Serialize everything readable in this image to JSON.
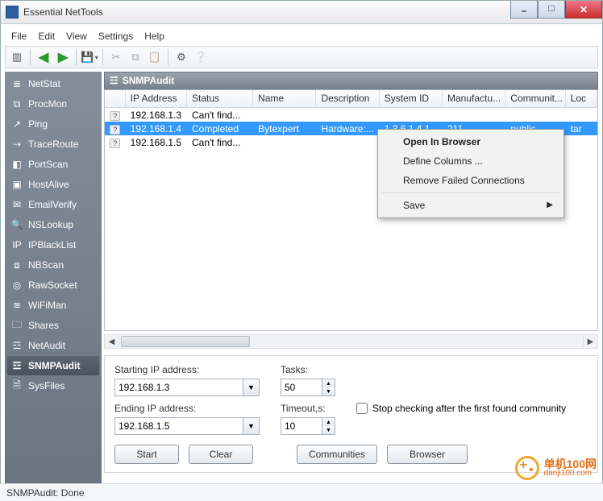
{
  "window": {
    "title": "Essential NetTools"
  },
  "menu": [
    "File",
    "Edit",
    "View",
    "Settings",
    "Help"
  ],
  "sidebar": {
    "items": [
      {
        "label": "NetStat",
        "icon": "≣"
      },
      {
        "label": "ProcMon",
        "icon": "⧉"
      },
      {
        "label": "Ping",
        "icon": "↗"
      },
      {
        "label": "TraceRoute",
        "icon": "⇢"
      },
      {
        "label": "PortScan",
        "icon": "◧"
      },
      {
        "label": "HostAlive",
        "icon": "▣"
      },
      {
        "label": "EmailVerify",
        "icon": "✉"
      },
      {
        "label": "NSLookup",
        "icon": "🔍"
      },
      {
        "label": "IPBlackList",
        "icon": "IP"
      },
      {
        "label": "NBScan",
        "icon": "⧈"
      },
      {
        "label": "RawSocket",
        "icon": "◎"
      },
      {
        "label": "WiFiMan",
        "icon": "≋"
      },
      {
        "label": "Shares",
        "icon": "🗀"
      },
      {
        "label": "NetAudit",
        "icon": "☲"
      },
      {
        "label": "SNMPAudit",
        "icon": "☲"
      },
      {
        "label": "SysFiles",
        "icon": "🗎"
      }
    ],
    "active_index": 14
  },
  "panel": {
    "title": "SNMPAudit",
    "icon": "☲"
  },
  "table": {
    "columns": [
      "",
      "IP Address",
      "Status",
      "Name",
      "Description",
      "System ID",
      "Manufactu...",
      "Communit...",
      "Loc"
    ],
    "rows": [
      {
        "ip": "192.168.1.3",
        "status": "Can't find...",
        "name": "",
        "desc": "",
        "sysid": "",
        "manu": "",
        "comm": "",
        "loc": "",
        "selected": false
      },
      {
        "ip": "192.168.1.4",
        "status": "Completed",
        "name": "Bytexpert",
        "desc": "Hardware:...",
        "sysid": "1.3.6.1.4.1....",
        "manu": "211",
        "comm": "public",
        "loc": "tar",
        "selected": true
      },
      {
        "ip": "192.168.1.5",
        "status": "Can't find...",
        "name": "",
        "desc": "",
        "sysid": "",
        "manu": "",
        "comm": "",
        "loc": "",
        "selected": false
      }
    ]
  },
  "context_menu": {
    "items": [
      {
        "label": "Open In Browser",
        "bold": true
      },
      {
        "label": "Define Columns ..."
      },
      {
        "label": "Remove Failed Connections"
      },
      {
        "sep": true
      },
      {
        "label": "Save",
        "submenu": true
      }
    ]
  },
  "form": {
    "start_ip_label": "Starting IP address:",
    "start_ip": "192.168.1.3",
    "end_ip_label": "Ending IP address:",
    "end_ip": "192.168.1.5",
    "tasks_label": "Tasks:",
    "tasks": "50",
    "timeout_label": "Timeout,s:",
    "timeout": "10",
    "stop_check_label": "Stop checking after the first found community",
    "buttons": {
      "start": "Start",
      "clear": "Clear",
      "communities": "Communities",
      "browser": "Browser"
    }
  },
  "status": "SNMPAudit: Done",
  "watermark": {
    "cn": "单机100网",
    "url": "danji100.com"
  }
}
